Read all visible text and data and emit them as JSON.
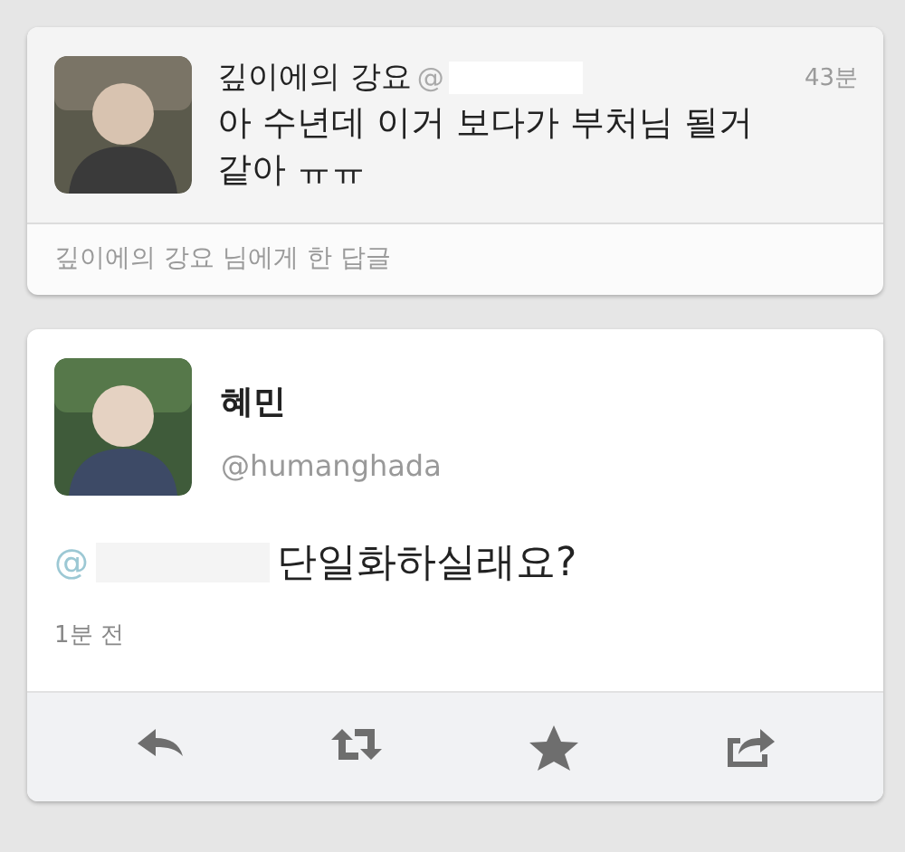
{
  "reply_tweet": {
    "name": "깊이에의 강요",
    "handle_prefix": "@",
    "time": "43분",
    "text": "아 수년데 이거 보다가 부처님 될거 같아 ㅠㅠ",
    "reply_note": "깊이에의 강요 님에게 한 답글"
  },
  "main_tweet": {
    "name": "혜민",
    "handle": "@humanghada",
    "mention_prefix": "@",
    "text": "단일화하실래요?",
    "time": "1분 전"
  },
  "actions": [
    {
      "kind": "reply"
    },
    {
      "kind": "retweet"
    },
    {
      "kind": "favorite"
    },
    {
      "kind": "share"
    }
  ]
}
